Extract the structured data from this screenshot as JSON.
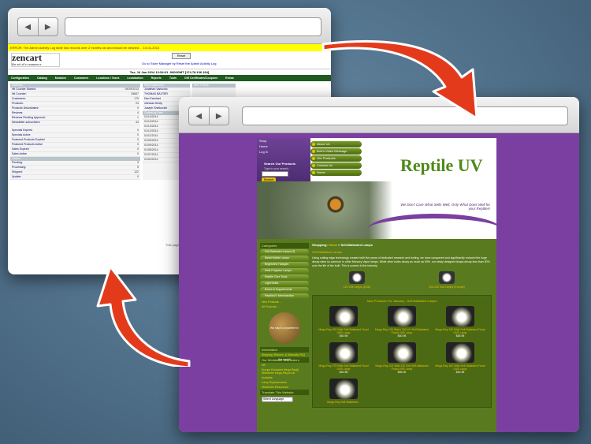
{
  "windows": {
    "back": {
      "nav_back": "◀",
      "nav_forward": "▶",
      "url": ""
    },
    "front": {
      "nav_back": "◀",
      "nav_forward": "▶",
      "url": ""
    }
  },
  "zencart": {
    "alert": "ERROR: The Admin Activity Log table has records over 2 months old and should be cleaned ... 10-01-2013",
    "logo_main": "zencart",
    "logo_sub": "the art of e-commerce",
    "reset_label": "Reset",
    "store_link": "Go to Store Manager by Reset the Admin Activity Log",
    "date_line": "Tue, 14 Jan 2014 12:54:01 -0600GMT [174.78.136.194]",
    "menu": [
      "Configuration",
      "Catalog",
      "Modules",
      "Customers",
      "Locations / Taxes",
      "Localization",
      "Reports",
      "Tools",
      "Gift Certificates/Coupons",
      "Extras"
    ],
    "stats_header": "Statistics",
    "stats": [
      {
        "label": "Hit Counter Started:",
        "value": "09/29/2013"
      },
      {
        "label": "Hit Counter:",
        "value": "25667"
      },
      {
        "label": "Customers:",
        "value": "175"
      },
      {
        "label": "Products:",
        "value": "23"
      },
      {
        "label": "Products Deactivated:",
        "value": "0"
      },
      {
        "label": "Reviews:",
        "value": "4"
      },
      {
        "label": "Reviews Pending Approval:",
        "value": "1"
      },
      {
        "label": "Newsletter subscribers:",
        "value": "43"
      }
    ],
    "specials": [
      {
        "label": "Specials Expired",
        "value": "0"
      },
      {
        "label": "Specials Active",
        "value": "0"
      },
      {
        "label": "Featured Products Expired",
        "value": "0"
      },
      {
        "label": "Featured Products Active",
        "value": "0"
      },
      {
        "label": "Sales Expired",
        "value": "0"
      },
      {
        "label": "Sales Active",
        "value": "0"
      }
    ],
    "orders_header": "Orders",
    "orders": [
      {
        "label": "Pending:",
        "value": "3"
      },
      {
        "label": "Processing:",
        "value": "5"
      },
      {
        "label": "Shipped:",
        "value": "122"
      },
      {
        "label": "Update:",
        "value": "0"
      }
    ],
    "customers_header": "New Customers",
    "new_customers": [
      "Jonathan Varischio",
      "THOMAS BAXTER",
      "Dan Earnhart",
      "nicholas finney",
      "Joseph Shelkovich"
    ],
    "orders_dates_header": "Orders by Date",
    "order_dates": [
      "01/14/2014",
      "01/13/2014",
      "01/13/2014",
      "01/12/2014",
      "01/11/2014",
      "01/09/2014",
      "01/09/2014",
      "01/08/2014",
      "01/07/2014",
      "01/04/2014"
    ],
    "other_header": "New Orders",
    "footer": "This page was ... without also being..."
  },
  "reptile": {
    "left_nav": {
      "shop": "Shop",
      "home": "Home",
      "login": "Log In"
    },
    "search": {
      "title": "Search Our Products",
      "placeholder": "Type in your search...",
      "button": "Search"
    },
    "top_nav": [
      "About Us",
      "Bob's Video Message",
      "Our Products",
      "Contact Us",
      "Home"
    ],
    "logo": "Reptile UV",
    "tagline": "We Don't Care What Sells Well, Only What Does Well for your Reptiles!",
    "categories_header": "Categories",
    "categories": [
      "Self-Ballasted Lamps (3)",
      "Metal Halide Lamps",
      "Brightcline Halogen",
      "Heat Projector Lamps",
      "Reptile Care Tools",
      "Light Bulbs",
      "Books & Supplements",
      "ReptileUV Merchandise"
    ],
    "new_products_link": "New Products ...",
    "all_products_link": "All Products ...",
    "globe_text": "We ship to anywhere in the world!",
    "info_header": "Information",
    "info_links": [
      "Shipping, Returns, & Warranty FAQ"
    ],
    "distributors_header": "Our Worldwide Distributors",
    "distributors": [
      "UK",
      "Europe Exclusive Mega Ray(t) Distributor Mega-Ray.co.uk",
      "Australia",
      "Lamp Replacements"
    ],
    "distributor_resources": "Distributor Resources",
    "language_label": "Translate This Website",
    "language_select": "Select Language",
    "breadcrumb_prefix": "Shopping:",
    "breadcrumb_home": "Home",
    "breadcrumb_current": "Self-Ballasted Lamps",
    "category_title": "Self-Ballasted Lamps",
    "category_desc": "Using cutting edge technology created with five years of dedicated research and testing, we have conquered and significantly reduced the huge decay rates so common in other Mercury Vapor lamps. While other bulbs decay as much as 50%, our newly designed lamps decay less than 30% over the life of the bulb. This is unseen in the industry.",
    "subcats": [
      "120 Volt Lamps (USA)",
      "220-240 Volt Lamps (Europe)"
    ],
    "new_products_header": "New Products For January - Self-Ballasted Lamps",
    "products": [
      {
        "name": "Mega-Ray 100 Watt Self-Ballasted Flood UVB Lamp",
        "price": "$40.95"
      },
      {
        "name": "Mega-Ray 100 Watt LOW UV Self Ballasted Flood UVB Lamp",
        "price": "$40.95"
      },
      {
        "name": "Mega-Ray 160 Watt Self-Ballasted Flood UVB Lamp",
        "price": "$46.95"
      },
      {
        "name": "Mega-Ray 275 Watt Self-Ballasted Flood UVB Lamp",
        "price": "$40.95"
      },
      {
        "name": "Mega-Ray 100 Watt 220 Volt Self-Ballasted Flood UVB Lamp",
        "price": "$59.00"
      },
      {
        "name": "Mega-Ray 160 Watt Self-Ballasted Flood UVB Lamp",
        "price": "$40.95"
      },
      {
        "name": "Mega-Ray Self-Ballasted...",
        "price": ""
      }
    ]
  },
  "colors": {
    "arrow": "#e43a1c",
    "purple_bg": "#7a3fa0",
    "site_green": "#5a7a1f"
  }
}
